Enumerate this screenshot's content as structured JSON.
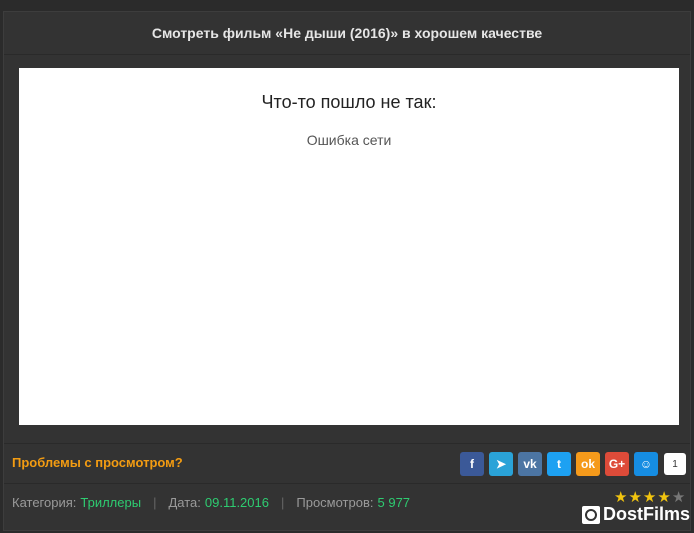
{
  "header": {
    "title": "Смотреть фильм «Не дыши (2016)» в хорошем качестве"
  },
  "player": {
    "error_title": "Что-то пошло не так:",
    "error_message": "Ошибка сети"
  },
  "footer": {
    "problems_link": "Проблемы с просмотром?",
    "share": {
      "buttons": [
        {
          "name": "facebook",
          "glyph": "f",
          "color": "#3b5998"
        },
        {
          "name": "telegram",
          "glyph": "➤",
          "color": "#2aa3d8"
        },
        {
          "name": "vkontakte",
          "glyph": "vk",
          "color": "#4c75a3"
        },
        {
          "name": "twitter",
          "glyph": "t",
          "color": "#1da1f2"
        },
        {
          "name": "odnoklassniki",
          "glyph": "ok",
          "color": "#f59a1b"
        },
        {
          "name": "google-plus",
          "glyph": "G+",
          "color": "#dd4b39"
        },
        {
          "name": "moi-mir",
          "glyph": "☺",
          "color": "#168de2"
        }
      ],
      "count": "1"
    },
    "meta": {
      "category_label": "Категория:",
      "category_value": "Триллеры",
      "date_label": "Дата:",
      "date_value": "09.11.2016",
      "views_label": "Просмотров:",
      "views_value": "5 977",
      "separator": "|"
    },
    "rating": {
      "filled": 4,
      "total": 5
    },
    "logo_text": "DostFilms"
  }
}
